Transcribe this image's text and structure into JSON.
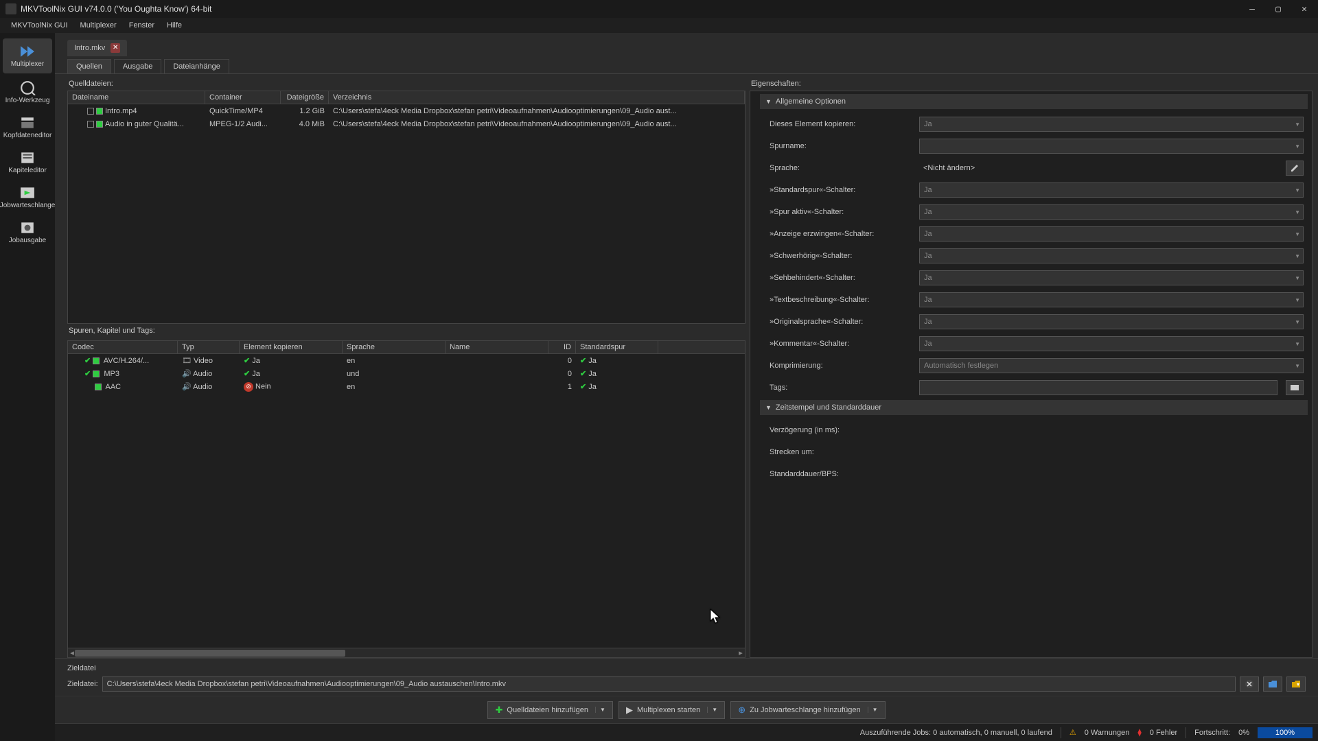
{
  "window": {
    "title": "MKVToolNix GUI v74.0.0 ('You Oughta Know') 64-bit"
  },
  "menus": {
    "app": "MKVToolNix GUI",
    "multiplexer": "Multiplexer",
    "fenster": "Fenster",
    "hilfe": "Hilfe"
  },
  "nav": {
    "multiplexer": "Multiplexer",
    "info": "Info-Werkzeug",
    "header": "Kopfdateneditor",
    "chapter": "Kapiteleditor",
    "queue": "Jobwarteschlange",
    "output": "Jobausgabe"
  },
  "tab": {
    "label": "Intro.mkv"
  },
  "subtabs": {
    "sources": "Quellen",
    "output": "Ausgabe",
    "attach": "Dateianhänge"
  },
  "labels": {
    "sourcefiles": "Quelldateien:",
    "tracks": "Spuren, Kapitel und Tags:",
    "properties": "Eigenschaften:",
    "outputSection": "Zieldatei",
    "outputFile": "Zieldatei:"
  },
  "src_cols": {
    "name": "Dateiname",
    "container": "Container",
    "size": "Dateigröße",
    "dir": "Verzeichnis"
  },
  "src_rows": [
    {
      "name": "Intro.mp4",
      "container": "QuickTime/MP4",
      "size": "1.2 GiB",
      "dir": "C:\\Users\\stefa\\4eck Media Dropbox\\stefan petri\\Videoaufnahmen\\Audiooptimierungen\\09_Audio aust..."
    },
    {
      "name": "Audio in guter Qualitä...",
      "container": "MPEG-1/2 Audi...",
      "size": "4.0 MiB",
      "dir": "C:\\Users\\stefa\\4eck Media Dropbox\\stefan petri\\Videoaufnahmen\\Audiooptimierungen\\09_Audio aust..."
    }
  ],
  "trk_cols": {
    "codec": "Codec",
    "typ": "Typ",
    "copy": "Element kopieren",
    "lang": "Sprache",
    "name": "Name",
    "id": "ID",
    "def": "Standardspur"
  },
  "trk_rows": [
    {
      "checked": true,
      "codec": "AVC/H.264/...",
      "typ": "Video",
      "copy": "Ja",
      "copyOk": true,
      "lang": "en",
      "id": "0",
      "def": "Ja",
      "typIcon": "video"
    },
    {
      "checked": true,
      "codec": "MP3",
      "typ": "Audio",
      "copy": "Ja",
      "copyOk": true,
      "lang": "und",
      "id": "0",
      "def": "Ja",
      "typIcon": "audio"
    },
    {
      "checked": false,
      "codec": "AAC",
      "typ": "Audio",
      "copy": "Nein",
      "copyOk": false,
      "lang": "en",
      "id": "1",
      "def": "Ja",
      "typIcon": "audio"
    }
  ],
  "props": {
    "group1": "Allgemeine Optionen",
    "group2": "Zeitstempel und Standarddauer",
    "copy_l": "Dieses Element kopieren:",
    "copy_v": "Ja",
    "trackname_l": "Spurname:",
    "trackname_v": "",
    "lang_l": "Sprache:",
    "lang_v": "<Nicht ändern>",
    "default_l": "»Standardspur«-Schalter:",
    "default_v": "Ja",
    "active_l": "»Spur aktiv«-Schalter:",
    "active_v": "Ja",
    "forced_l": "»Anzeige erzwingen«-Schalter:",
    "forced_v": "Ja",
    "hearing_l": "»Schwerhörig«-Schalter:",
    "hearing_v": "Ja",
    "visual_l": "»Sehbehindert«-Schalter:",
    "visual_v": "Ja",
    "textdesc_l": "»Textbeschreibung«-Schalter:",
    "textdesc_v": "Ja",
    "origlang_l": "»Originalsprache«-Schalter:",
    "origlang_v": "Ja",
    "comment_l": "»Kommentar«-Schalter:",
    "comment_v": "Ja",
    "compress_l": "Komprimierung:",
    "compress_v": "Automatisch festlegen",
    "tags_l": "Tags:",
    "tags_v": "",
    "delay_l": "Verzögerung (in ms):",
    "stretch_l": "Strecken um:",
    "dur_l": "Standarddauer/BPS:"
  },
  "output": {
    "path": "C:\\Users\\stefa\\4eck Media Dropbox\\stefan petri\\Videoaufnahmen\\Audiooptimierungen\\09_Audio austauschen\\Intro.mkv"
  },
  "actions": {
    "addsrc": "Quelldateien hinzufügen",
    "start": "Multiplexen starten",
    "toqueue": "Zu Jobwarteschlange hinzufügen"
  },
  "status": {
    "jobs": "Auszuführende Jobs:  0 automatisch, 0 manuell, 0 laufend",
    "warn": "0 Warnungen",
    "err": "0 Fehler",
    "progress": "Fortschritt:",
    "val0": "0%",
    "val100": "100%"
  }
}
